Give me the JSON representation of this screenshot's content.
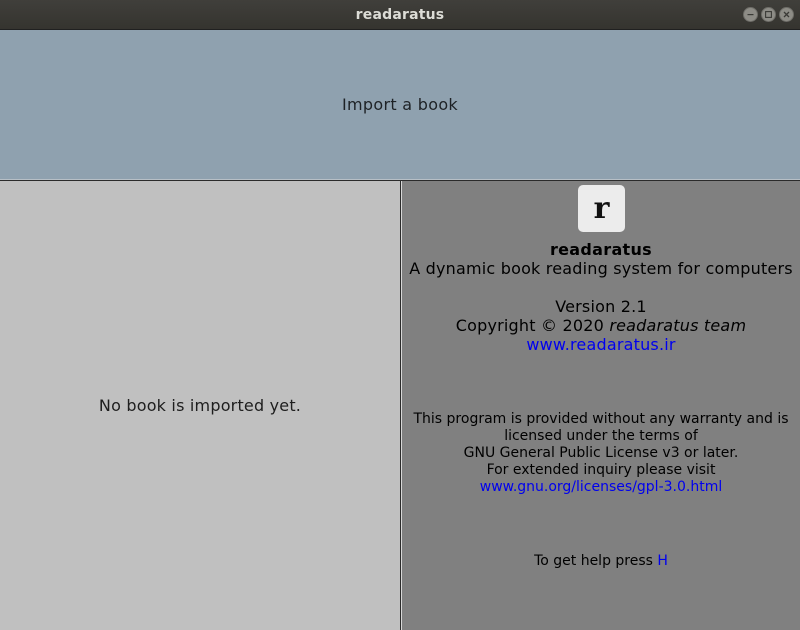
{
  "window": {
    "title": "readaratus"
  },
  "import": {
    "mnemonic": "I",
    "label_rest": "mport a book"
  },
  "left_pane": {
    "empty_message": "No book is imported yet."
  },
  "about": {
    "logo_glyph": "r",
    "app_name": "readaratus",
    "description": "A dynamic book reading system for computers",
    "version": "Version 2.1",
    "copyright_prefix": "Copyright © 2020 ",
    "copyright_team": "readaratus team",
    "website": "www.readaratus.ir",
    "license_lines": [
      "This program is provided without any warranty and is",
      "licensed under the terms of",
      "GNU General Public License v3 or later.",
      "For extended inquiry please visit"
    ],
    "license_link": "www.gnu.org/licenses/gpl-3.0.html",
    "help_prefix": "To get help press ",
    "help_key": "H"
  },
  "colors": {
    "import_bg": "#8fa1af",
    "left_bg": "#c0c0c0",
    "right_bg": "#808080",
    "link": "#0000ee"
  }
}
